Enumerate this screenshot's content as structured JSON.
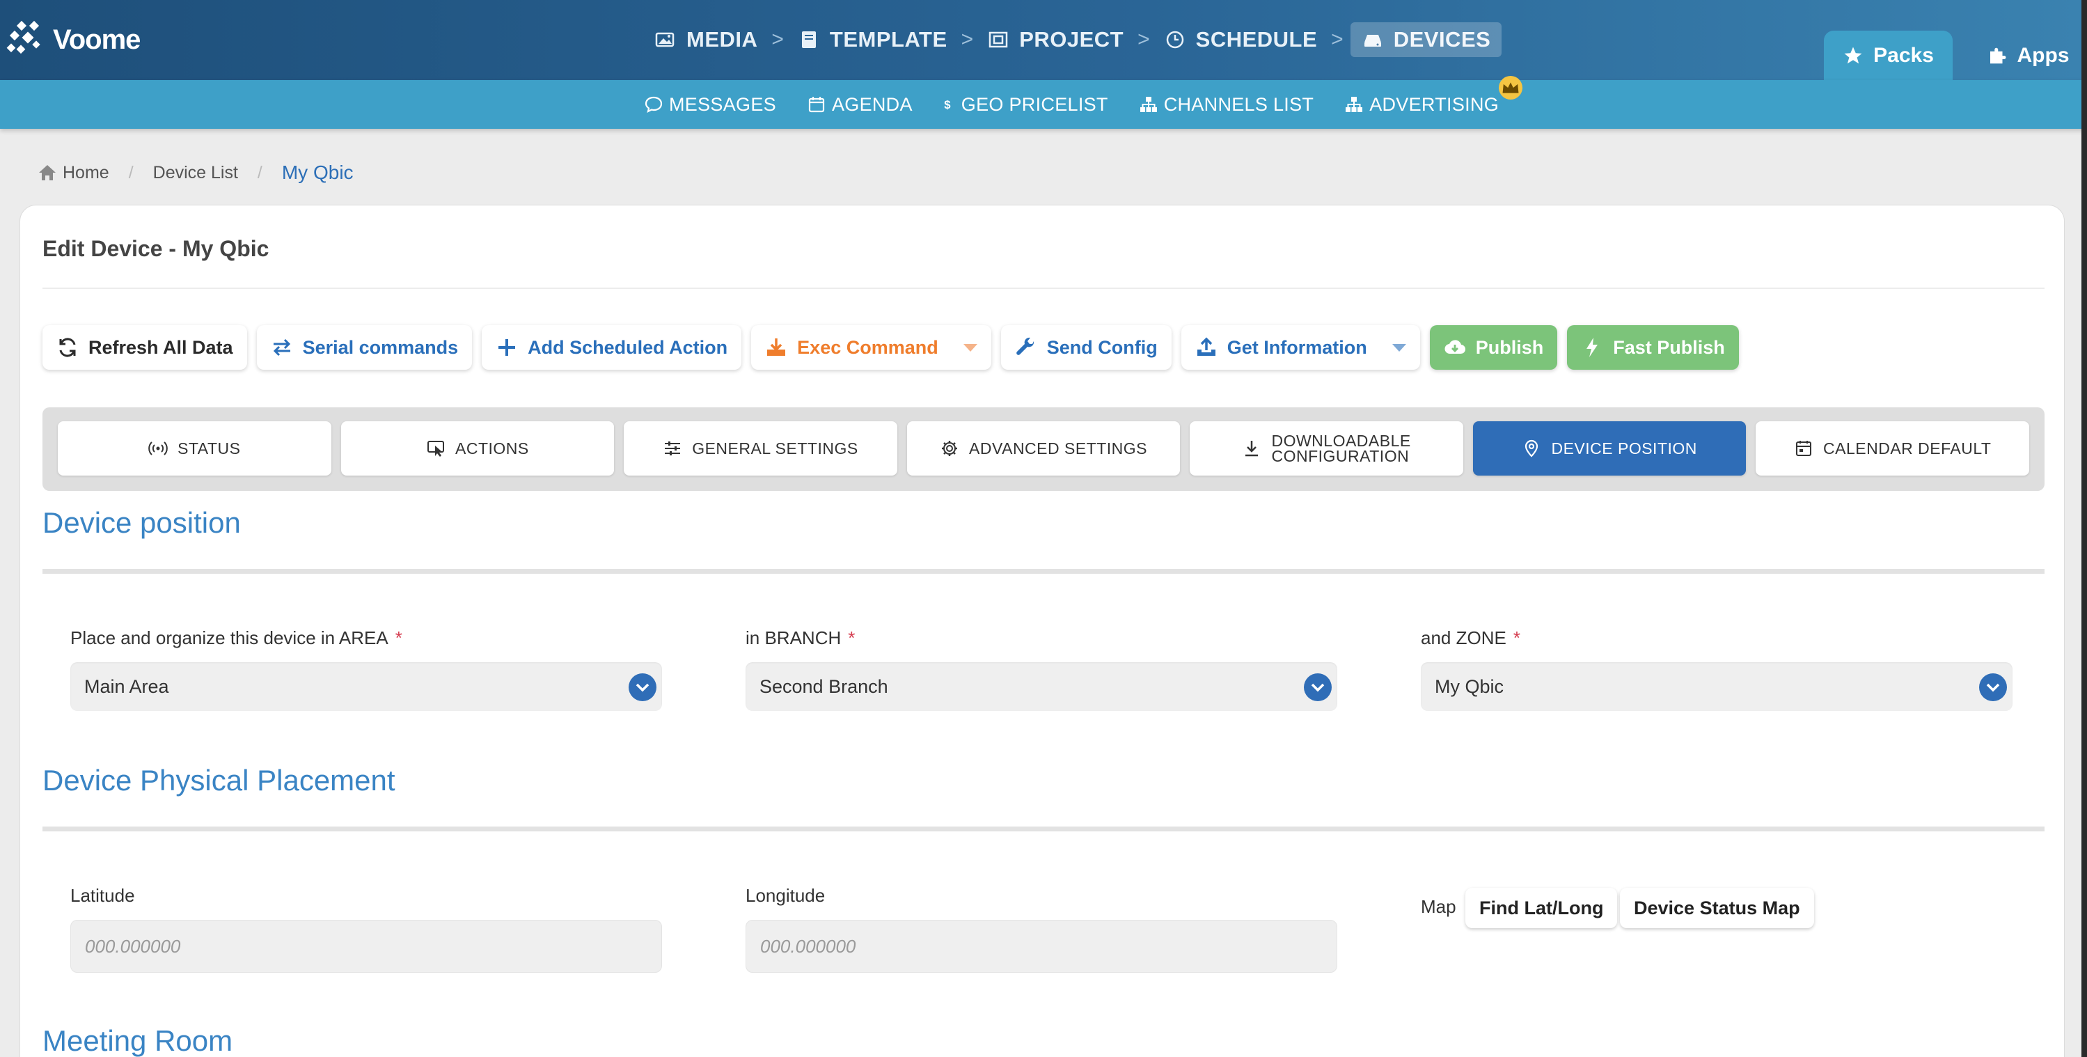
{
  "brand": {
    "name": "Voome"
  },
  "top_nav": [
    {
      "label": "MEDIA",
      "icon": "image-icon"
    },
    {
      "label": "TEMPLATE",
      "icon": "book-icon"
    },
    {
      "label": "PROJECT",
      "icon": "project-icon"
    },
    {
      "label": "SCHEDULE",
      "icon": "clock-icon"
    },
    {
      "label": "DEVICES",
      "icon": "devices-icon",
      "active": true
    }
  ],
  "top_nav_separator": ">",
  "top_right": {
    "packs": "Packs",
    "apps": "Apps"
  },
  "sub_nav": [
    {
      "label": "MESSAGES",
      "icon": "chat-icon"
    },
    {
      "label": "AGENDA",
      "icon": "calendar-icon"
    },
    {
      "label": "GEO PRICELIST",
      "icon": "dollar-icon"
    },
    {
      "label": "CHANNELS LIST",
      "icon": "sitemap-icon"
    },
    {
      "label": "ADVERTISING",
      "icon": "sitemap-icon",
      "badge": "crown-icon"
    }
  ],
  "breadcrumb": {
    "home": "Home",
    "device_list": "Device List",
    "current": "My Qbic",
    "separator": "/"
  },
  "page": {
    "title": "Edit Device - My Qbic"
  },
  "toolbar": {
    "refresh": "Refresh All Data",
    "serial": "Serial commands",
    "add_action": "Add Scheduled Action",
    "exec": "Exec Command",
    "send_config": "Send Config",
    "get_info": "Get Information",
    "publish": "Publish",
    "fast_publish": "Fast Publish"
  },
  "tabs": {
    "status": "STATUS",
    "actions": "ACTIONS",
    "general": "GENERAL SETTINGS",
    "advanced": "ADVANCED SETTINGS",
    "download_1": "DOWNLOADABLE",
    "download_2": "CONFIGURATION",
    "position": "DEVICE POSITION",
    "calendar": "CALENDAR DEFAULT"
  },
  "device_position": {
    "title": "Device position",
    "area_label": "Place and organize this device in AREA",
    "area_value": "Main Area",
    "branch_label": "in BRANCH",
    "branch_value": "Second Branch",
    "zone_label": "and ZONE",
    "zone_value": "My Qbic",
    "required_mark": "*"
  },
  "physical_placement": {
    "title": "Device Physical Placement",
    "latitude_label": "Latitude",
    "latitude_placeholder": "000.000000",
    "longitude_label": "Longitude",
    "longitude_placeholder": "000.000000",
    "map_label": "Map",
    "find_button": "Find Lat/Long",
    "status_map_button": "Device Status Map"
  },
  "meeting_room": {
    "title": "Meeting Room"
  },
  "colors": {
    "primary": "#2f6db7",
    "topbar": "#1e4f7a",
    "subbar": "#3ea0c8",
    "orange": "#ef7d2c",
    "green": "#7cc47a",
    "required": "#d43a4d"
  }
}
